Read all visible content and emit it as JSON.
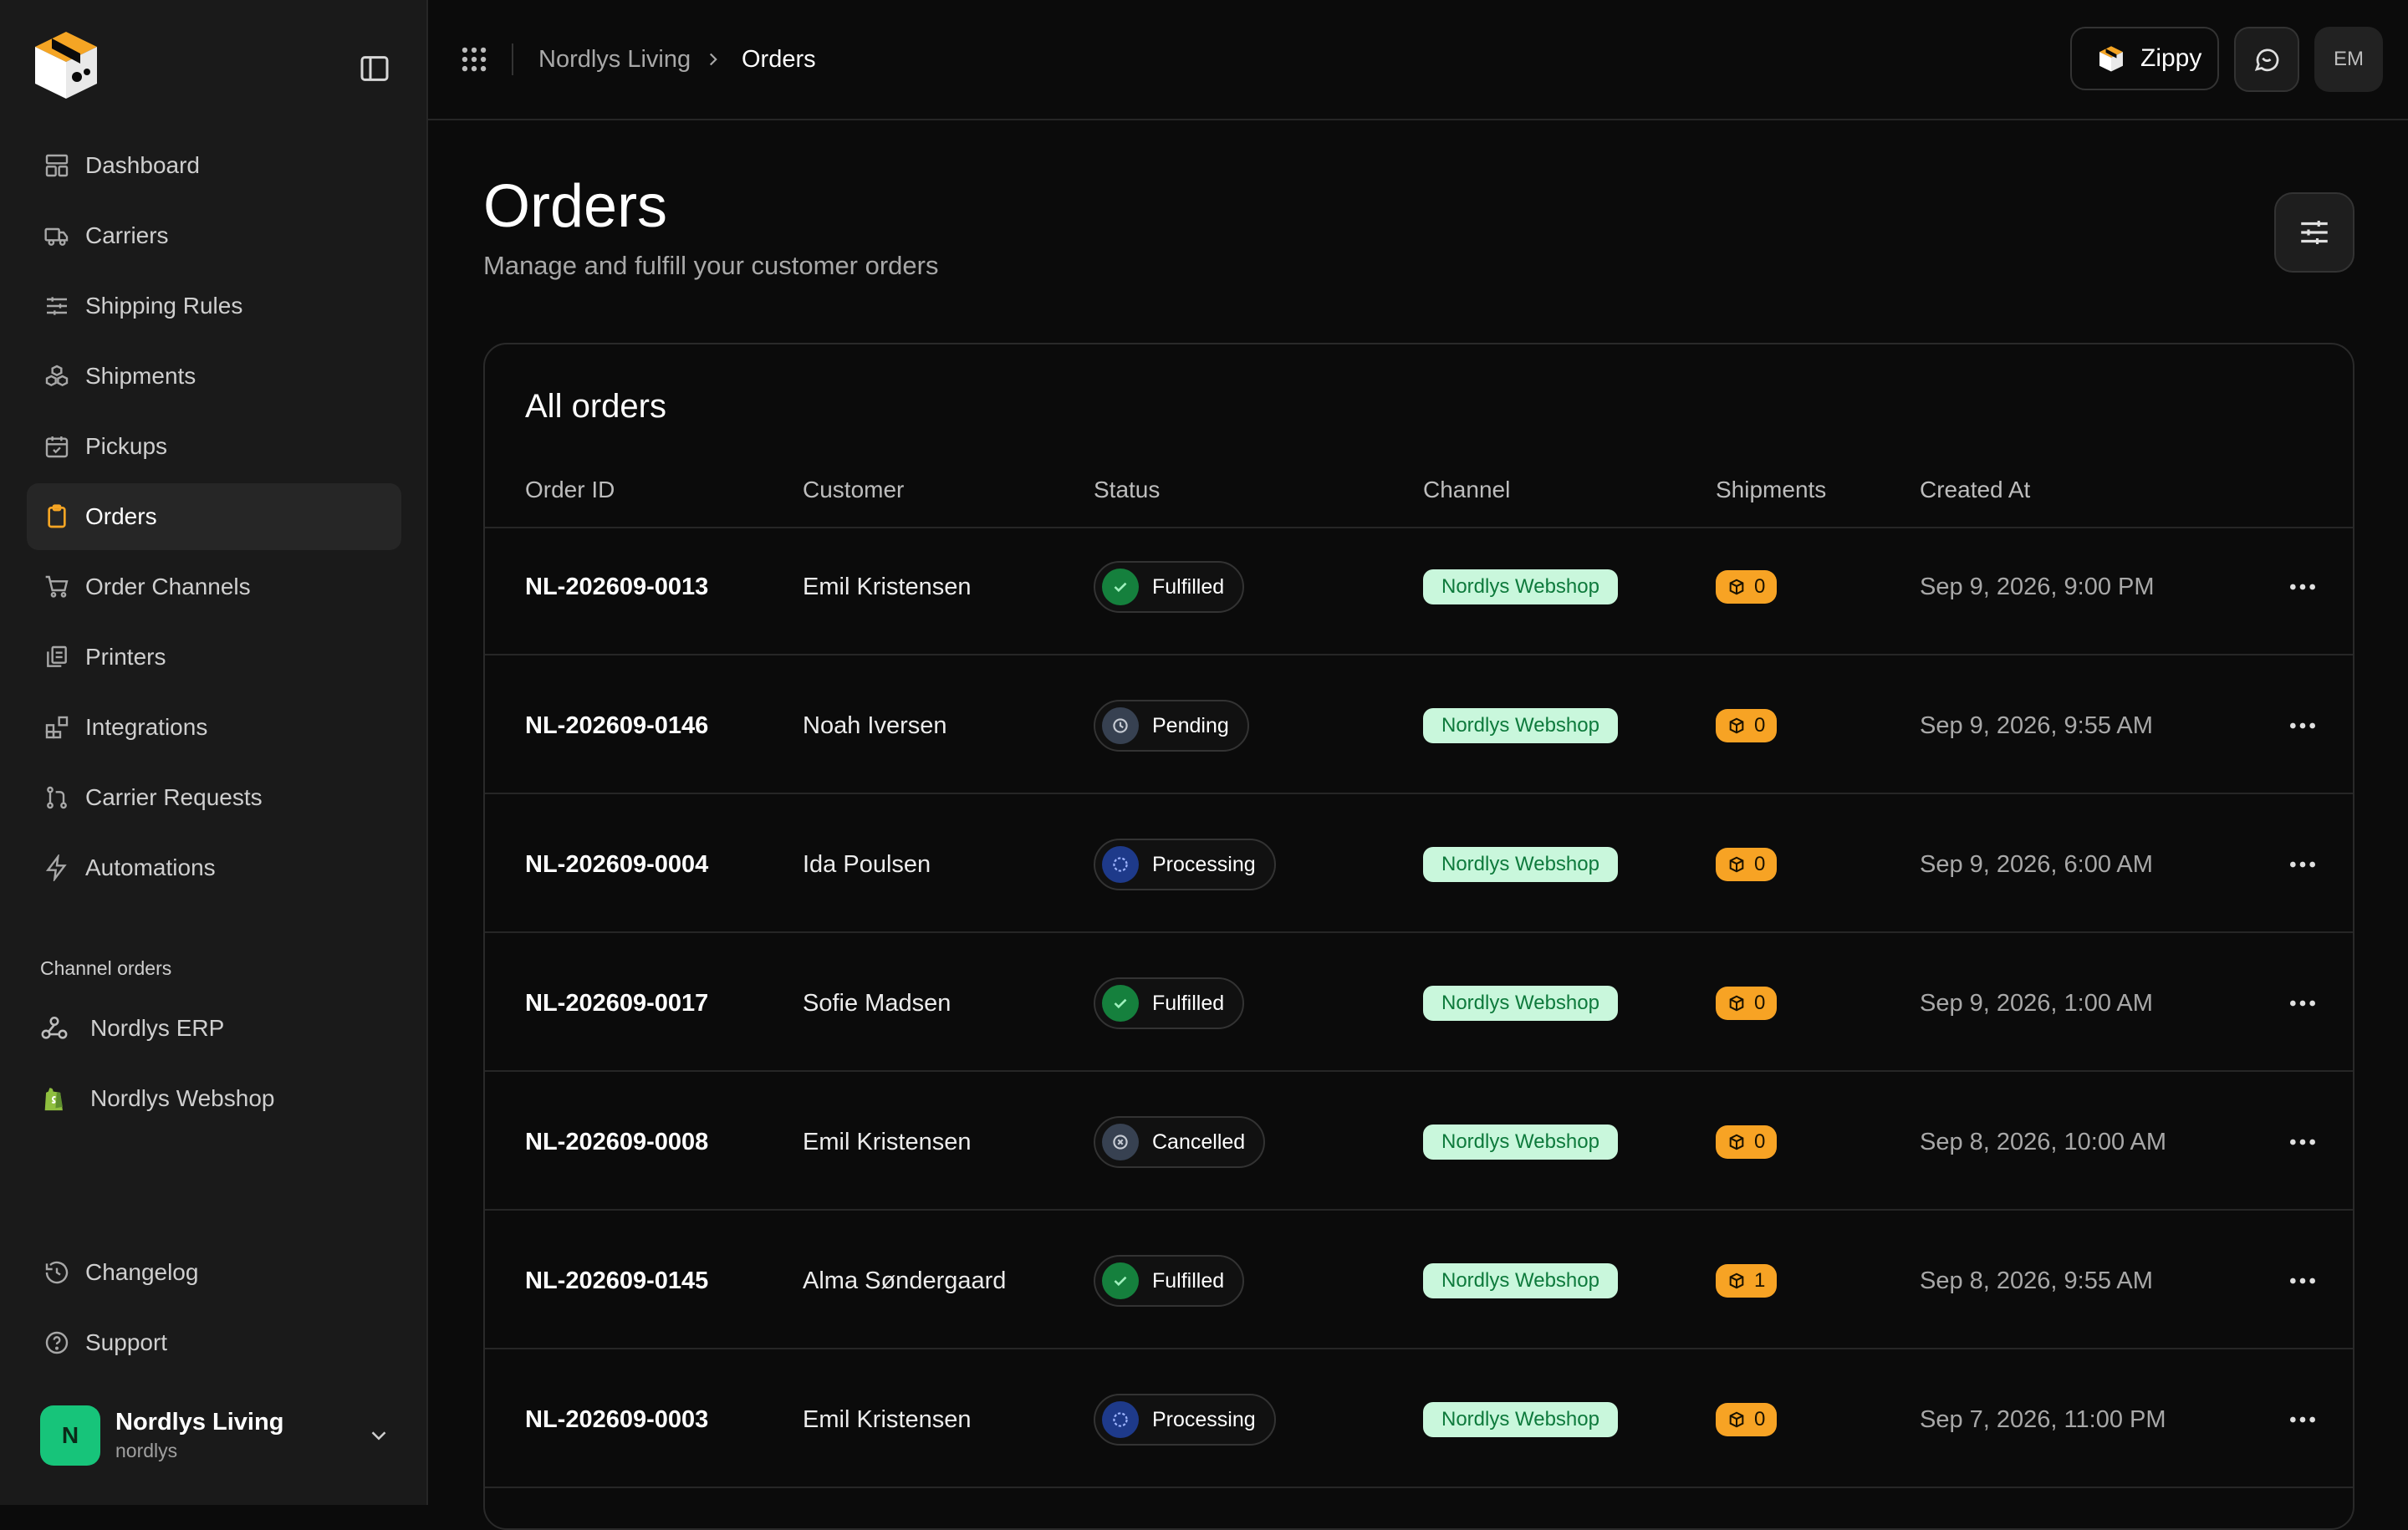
{
  "nav": {
    "items": [
      {
        "label": "Dashboard",
        "icon": "layout-grid-icon"
      },
      {
        "label": "Carriers",
        "icon": "truck-icon"
      },
      {
        "label": "Shipping Rules",
        "icon": "sliders-icon"
      },
      {
        "label": "Shipments",
        "icon": "boxes-icon"
      },
      {
        "label": "Pickups",
        "icon": "calendar-check-icon"
      },
      {
        "label": "Orders",
        "icon": "clipboard-icon",
        "active": true
      },
      {
        "label": "Order Channels",
        "icon": "cart-icon"
      },
      {
        "label": "Printers",
        "icon": "printer-icon"
      },
      {
        "label": "Integrations",
        "icon": "blocks-icon"
      },
      {
        "label": "Carrier Requests",
        "icon": "git-pull-icon"
      },
      {
        "label": "Automations",
        "icon": "zap-icon"
      }
    ],
    "channel_section_label": "Channel orders",
    "channels": [
      {
        "label": "Nordlys ERP",
        "icon": "webhook-icon"
      },
      {
        "label": "Nordlys Webshop",
        "icon": "shopify-bag-icon"
      }
    ],
    "bottom": [
      {
        "label": "Changelog",
        "icon": "history-icon"
      },
      {
        "label": "Support",
        "icon": "help-circle-icon"
      }
    ],
    "user": {
      "initial": "N",
      "name": "Nordlys Living",
      "handle": "nordlys"
    }
  },
  "topbar": {
    "breadcrumb": [
      "Nordlys Living",
      "Orders"
    ],
    "zippy_label": "Zippy",
    "user_initials": "EM"
  },
  "page": {
    "title": "Orders",
    "subtitle": "Manage and fulfill your customer orders"
  },
  "table": {
    "title": "All orders",
    "columns": [
      "Order ID",
      "Customer",
      "Status",
      "Channel",
      "Shipments",
      "Created At"
    ],
    "rows": [
      {
        "id": "NL-202609-0013",
        "customer": "Emil Kristensen",
        "status": "Fulfilled",
        "channel": "Nordlys Webshop",
        "shipments": "0",
        "created": "Sep 9, 2026, 9:00 PM"
      },
      {
        "id": "NL-202609-0146",
        "customer": "Noah Iversen",
        "status": "Pending",
        "channel": "Nordlys Webshop",
        "shipments": "0",
        "created": "Sep 9, 2026, 9:55 AM"
      },
      {
        "id": "NL-202609-0004",
        "customer": "Ida Poulsen",
        "status": "Processing",
        "channel": "Nordlys Webshop",
        "shipments": "0",
        "created": "Sep 9, 2026, 6:00 AM"
      },
      {
        "id": "NL-202609-0017",
        "customer": "Sofie Madsen",
        "status": "Fulfilled",
        "channel": "Nordlys Webshop",
        "shipments": "0",
        "created": "Sep 9, 2026, 1:00 AM"
      },
      {
        "id": "NL-202609-0008",
        "customer": "Emil Kristensen",
        "status": "Cancelled",
        "channel": "Nordlys Webshop",
        "shipments": "0",
        "created": "Sep 8, 2026, 10:00 AM"
      },
      {
        "id": "NL-202609-0145",
        "customer": "Alma Søndergaard",
        "status": "Fulfilled",
        "channel": "Nordlys Webshop",
        "shipments": "1",
        "created": "Sep 8, 2026, 9:55 AM"
      },
      {
        "id": "NL-202609-0003",
        "customer": "Emil Kristensen",
        "status": "Processing",
        "channel": "Nordlys Webshop",
        "shipments": "0",
        "created": "Sep 7, 2026, 11:00 PM"
      }
    ]
  },
  "colors": {
    "accent": "#f5a524",
    "fulfilled": "#15803d",
    "pending": "#374151",
    "processing": "#1e3a8a",
    "cancelled": "#374151",
    "channel_badge_bg": "#c9f7dc",
    "shipment_badge_bg": "#f7a324"
  }
}
